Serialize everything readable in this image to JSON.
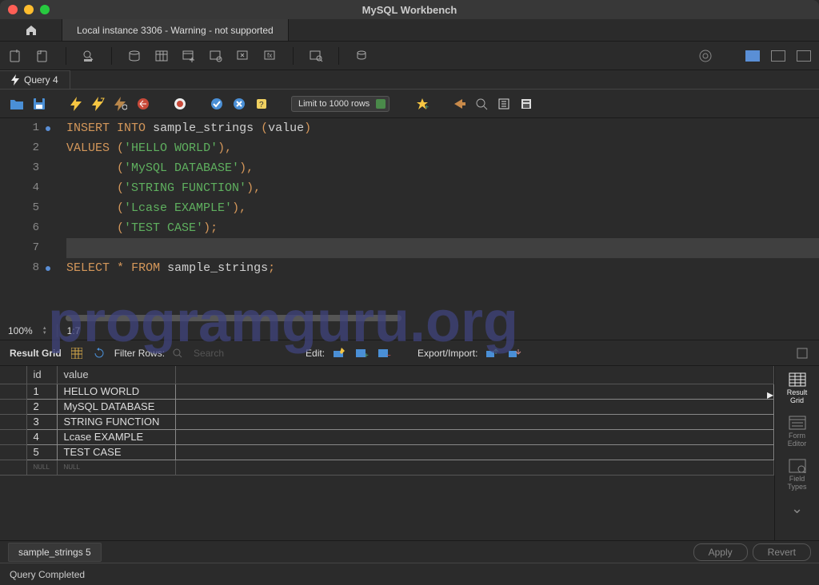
{
  "window": {
    "title": "MySQL Workbench"
  },
  "connection_tab": "Local instance 3306 - Warning - not supported",
  "query_tab": "Query 4",
  "editor_toolbar": {
    "limit": "Limit to 1000 rows"
  },
  "zoom": {
    "percent": "100%",
    "pos": "1:7"
  },
  "code": {
    "lines": [
      {
        "n": "1",
        "has_dot": true,
        "current": false,
        "segments": [
          {
            "t": "INSERT",
            "c": "kw"
          },
          {
            "t": " ",
            "c": ""
          },
          {
            "t": "INTO",
            "c": "kw"
          },
          {
            "t": " ",
            "c": ""
          },
          {
            "t": "sample_strings",
            "c": "ident"
          },
          {
            "t": " ",
            "c": ""
          },
          {
            "t": "(",
            "c": "punct"
          },
          {
            "t": "value",
            "c": "ident"
          },
          {
            "t": ")",
            "c": "punct"
          }
        ]
      },
      {
        "n": "2",
        "has_dot": false,
        "current": false,
        "segments": [
          {
            "t": "VALUES",
            "c": "kw"
          },
          {
            "t": " ",
            "c": ""
          },
          {
            "t": "(",
            "c": "punct"
          },
          {
            "t": "'HELLO WORLD'",
            "c": "str"
          },
          {
            "t": ")",
            "c": "punct"
          },
          {
            "t": ",",
            "c": "punct"
          }
        ]
      },
      {
        "n": "3",
        "has_dot": false,
        "current": false,
        "segments": [
          {
            "t": "       ",
            "c": ""
          },
          {
            "t": "(",
            "c": "punct"
          },
          {
            "t": "'MySQL DATABASE'",
            "c": "str"
          },
          {
            "t": ")",
            "c": "punct"
          },
          {
            "t": ",",
            "c": "punct"
          }
        ]
      },
      {
        "n": "4",
        "has_dot": false,
        "current": false,
        "segments": [
          {
            "t": "       ",
            "c": ""
          },
          {
            "t": "(",
            "c": "punct"
          },
          {
            "t": "'STRING FUNCTION'",
            "c": "str"
          },
          {
            "t": ")",
            "c": "punct"
          },
          {
            "t": ",",
            "c": "punct"
          }
        ]
      },
      {
        "n": "5",
        "has_dot": false,
        "current": false,
        "segments": [
          {
            "t": "       ",
            "c": ""
          },
          {
            "t": "(",
            "c": "punct"
          },
          {
            "t": "'Lcase EXAMPLE'",
            "c": "str"
          },
          {
            "t": ")",
            "c": "punct"
          },
          {
            "t": ",",
            "c": "punct"
          }
        ]
      },
      {
        "n": "6",
        "has_dot": false,
        "current": false,
        "segments": [
          {
            "t": "       ",
            "c": ""
          },
          {
            "t": "(",
            "c": "punct"
          },
          {
            "t": "'TEST CASE'",
            "c": "str"
          },
          {
            "t": ")",
            "c": "punct"
          },
          {
            "t": ";",
            "c": "punct"
          }
        ]
      },
      {
        "n": "7",
        "has_dot": false,
        "current": true,
        "segments": []
      },
      {
        "n": "8",
        "has_dot": true,
        "current": false,
        "segments": [
          {
            "t": "SELECT",
            "c": "kw"
          },
          {
            "t": " ",
            "c": ""
          },
          {
            "t": "*",
            "c": "punct"
          },
          {
            "t": " ",
            "c": ""
          },
          {
            "t": "FROM",
            "c": "kw"
          },
          {
            "t": " ",
            "c": ""
          },
          {
            "t": "sample_strings",
            "c": "ident"
          },
          {
            "t": ";",
            "c": "punct"
          }
        ]
      }
    ]
  },
  "result_toolbar": {
    "label": "Result Grid",
    "filter_label": "Filter Rows:",
    "filter_placeholder": "Search",
    "edit_label": "Edit:",
    "export_label": "Export/Import:"
  },
  "grid": {
    "columns": [
      "",
      "id",
      "value"
    ],
    "rows": [
      [
        "",
        "1",
        "HELLO WORLD"
      ],
      [
        "",
        "2",
        "MySQL DATABASE"
      ],
      [
        "",
        "3",
        "STRING FUNCTION"
      ],
      [
        "",
        "4",
        "Lcase EXAMPLE"
      ],
      [
        "",
        "5",
        "TEST CASE"
      ]
    ],
    "null_label": "NULL"
  },
  "right_panel": {
    "result_grid": "Result\nGrid",
    "form_editor": "Form\nEditor",
    "field_types": "Field\nTypes"
  },
  "bottom": {
    "tab": "sample_strings 5",
    "apply": "Apply",
    "revert": "Revert"
  },
  "status": "Query Completed",
  "watermark": "programguru.org"
}
